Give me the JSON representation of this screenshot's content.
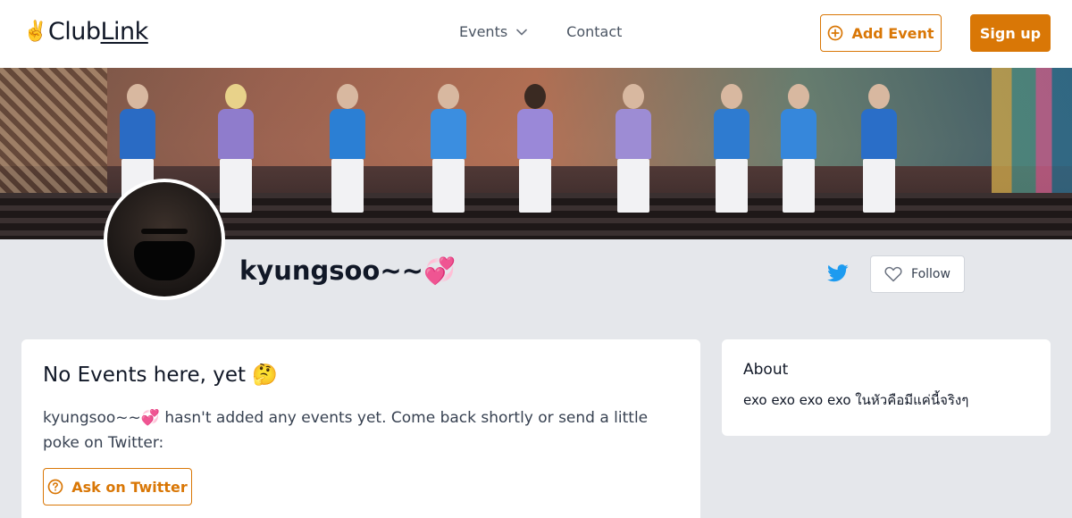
{
  "header": {
    "logo_emoji": "✌️",
    "logo_club": "Club",
    "logo_link": "Link",
    "nav": {
      "events_label": "Events",
      "contact_label": "Contact"
    },
    "add_event_label": "Add Event",
    "sign_up_label": "Sign up"
  },
  "profile": {
    "name": "kyungsoo~~💞",
    "follow_label": "Follow"
  },
  "events_card": {
    "title": "No Events here, yet 🤔",
    "message": "kyungsoo~~💞 hasn't added any events yet. Come back shortly or send a little poke on Twitter:",
    "ask_label": "Ask on Twitter"
  },
  "about_card": {
    "title": "About",
    "text": "exo exo exo exo ในหัวคือมีแค่นี้จริงๆ"
  },
  "colors": {
    "accent": "#d97706",
    "twitter": "#1d9bf0",
    "page_bg": "#e5e7eb"
  },
  "icons": {
    "events_chevron": "chevron-down-icon",
    "add_event": "plus-circle-icon",
    "twitter": "twitter-icon",
    "follow": "heart-icon",
    "ask": "question-circle-icon"
  }
}
